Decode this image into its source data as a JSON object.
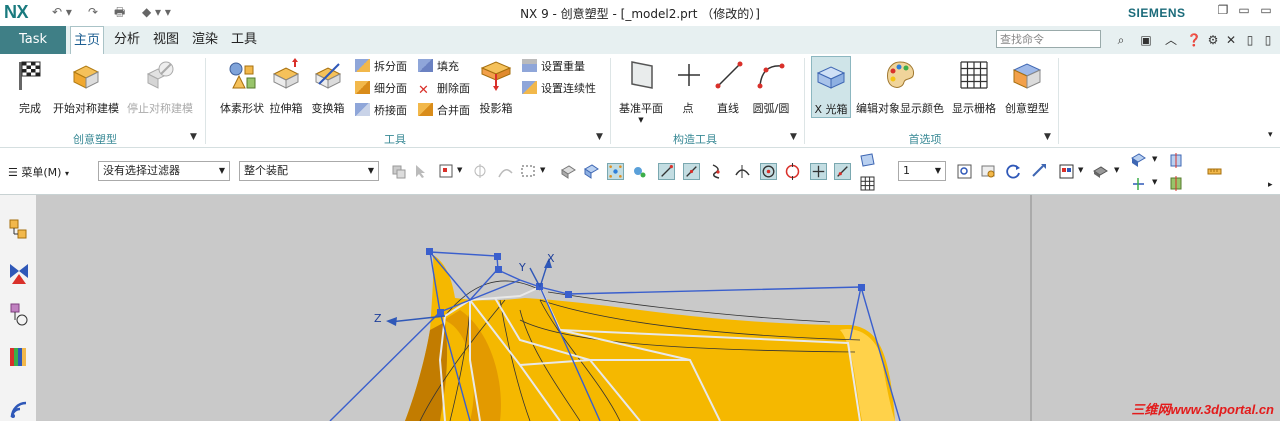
{
  "app": {
    "logo": "NX",
    "title": "NX 9 - 创意塑型 - [_model2.prt （修改的）]",
    "brand": "SIEMENS"
  },
  "tabs": {
    "task": "Task",
    "items": [
      "主页",
      "分析",
      "视图",
      "渲染",
      "工具"
    ],
    "active": "主页"
  },
  "search": {
    "placeholder": "查找命令"
  },
  "ribbon": {
    "groups": {
      "chuangyi": {
        "label": "创意塑型",
        "buttons": [
          "完成",
          "开始对称建模",
          "停止对称建模"
        ]
      },
      "gongju": {
        "label": "工具",
        "big": [
          "体素形状",
          "拉伸箱",
          "变换箱"
        ],
        "small_col1": [
          "拆分面",
          "细分面",
          "桥接面"
        ],
        "small_col2": [
          "填充",
          "删除面",
          "合并面"
        ],
        "big2": "投影箱",
        "small_col3": [
          "设置重量",
          "设置连续性"
        ]
      },
      "gouzao": {
        "label": "构造工具",
        "buttons": [
          "基准平面",
          "点",
          "直线",
          "圆弧/圆"
        ]
      },
      "shouxuan": {
        "label": "首选项",
        "buttons": [
          "X 光箱",
          "编辑对象显示颜色",
          "显示栅格",
          "创意塑型"
        ]
      }
    }
  },
  "toolbar": {
    "menu_label": "菜单(M)",
    "filter_value": "没有选择过滤器",
    "scope_value": "整个装配",
    "layer_value": "1"
  },
  "viewport": {
    "axis_labels": [
      "X",
      "Y",
      "Z"
    ]
  },
  "watermark": "三维网www.3dportal.cn",
  "colors": {
    "accent": "#3f7f86",
    "model": "#f5b800",
    "cage": "#3a5fcd",
    "viewport_bg": "#c9c9c9"
  }
}
